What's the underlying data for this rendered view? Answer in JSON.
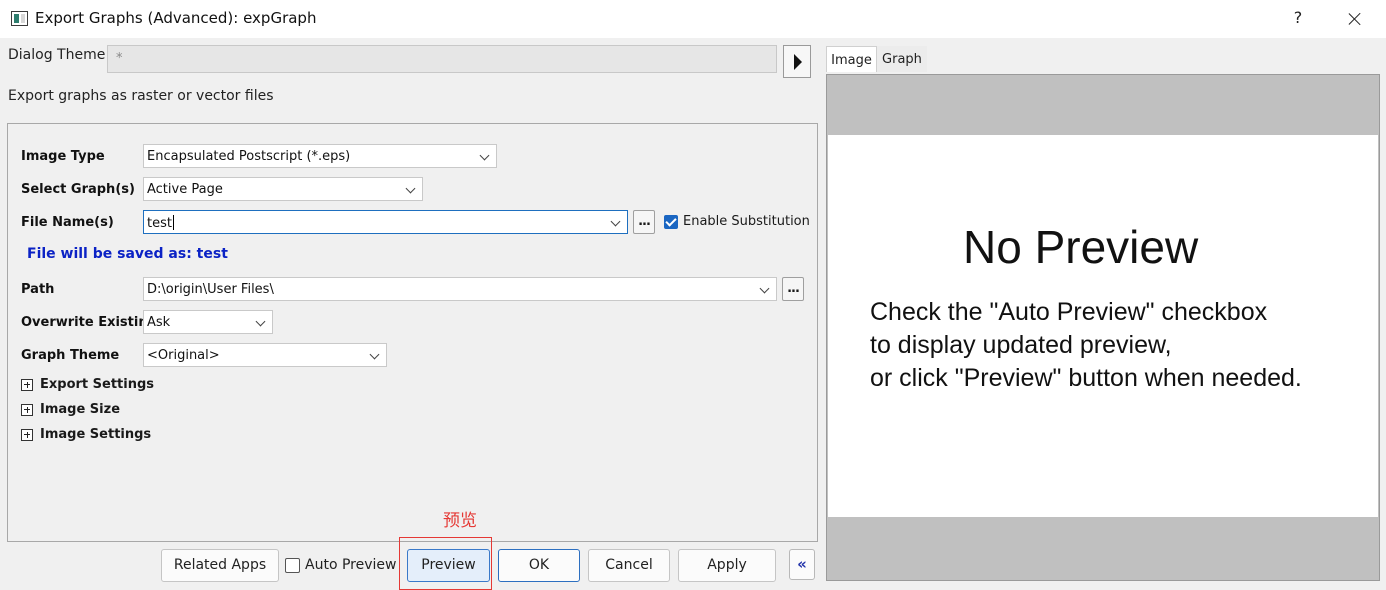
{
  "window": {
    "title": "Export Graphs (Advanced): expGraph",
    "help_label": "?"
  },
  "dialog_theme": {
    "label": "Dialog Theme",
    "value": "*"
  },
  "description": "Export graphs as raster or vector files",
  "settings": {
    "image_type": {
      "label": "Image Type",
      "value": "Encapsulated Postscript (*.eps)"
    },
    "select_graphs": {
      "label": "Select Graph(s)",
      "value": "Active Page"
    },
    "file_names": {
      "label": "File Name(s)",
      "value": "test",
      "browse_label": "...",
      "enable_substitution": {
        "label": "Enable Substitution",
        "checked": true
      }
    },
    "save_as_text": "File will be saved as: test",
    "path": {
      "label": "Path",
      "value": "D:\\origin\\User Files\\",
      "browse_label": "..."
    },
    "overwrite": {
      "label": "Overwrite Existing",
      "value": "Ask"
    },
    "graph_theme": {
      "label": "Graph Theme",
      "value": "<Original>"
    },
    "groups": [
      {
        "label": "Export Settings"
      },
      {
        "label": "Image Size"
      },
      {
        "label": "Image Settings"
      }
    ]
  },
  "annotation": {
    "text": "预览",
    "color": "#e53935"
  },
  "buttons": {
    "related_apps": "Related Apps",
    "auto_preview": {
      "label": "Auto Preview",
      "checked": false
    },
    "preview": "Preview",
    "ok": "OK",
    "cancel": "Cancel",
    "apply": "Apply",
    "collapse": "«"
  },
  "preview_panel": {
    "tabs": [
      {
        "label": "Image",
        "active": true
      },
      {
        "label": "Graph",
        "active": false
      }
    ],
    "no_preview_title": "No Preview",
    "message_lines": [
      "Check the \"Auto Preview\" checkbox",
      "to display updated preview,",
      "or click \"Preview\" button when needed."
    ]
  }
}
